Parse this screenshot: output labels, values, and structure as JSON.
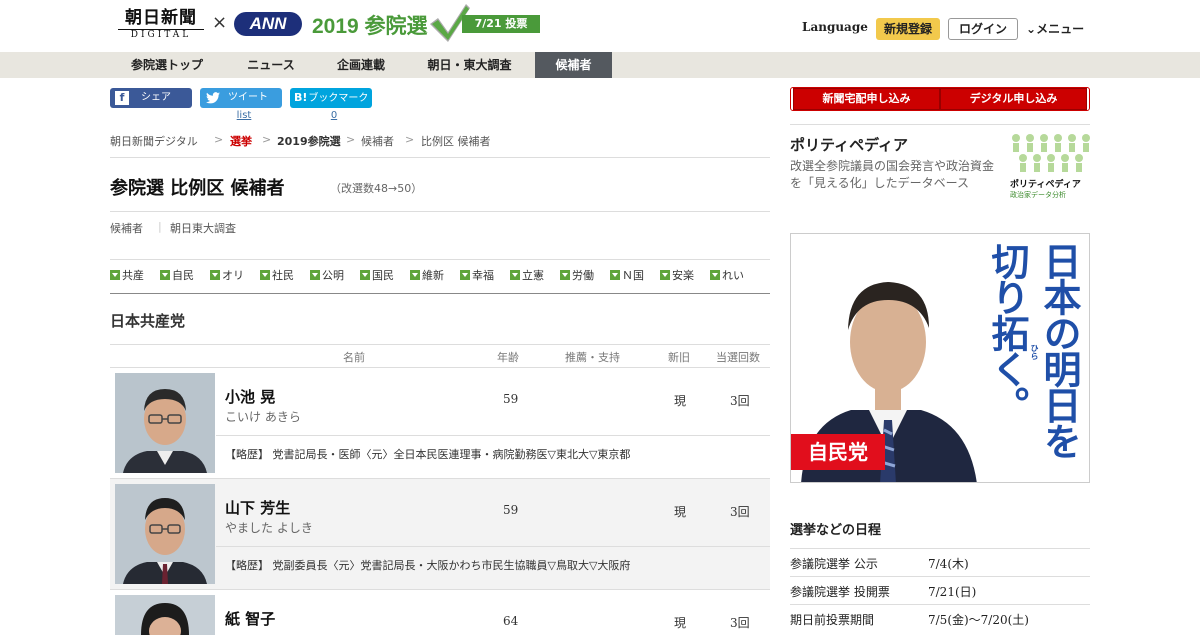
{
  "header": {
    "logo_asahi": "朝日新聞",
    "logo_digital": "DIGITAL",
    "logo_x": "×",
    "logo_ann": "ANN",
    "logo_election": "2019 参院選",
    "logo_vote": "7/21 投票",
    "language": "Language",
    "register": "新規登録",
    "login": "ログイン",
    "menu": "メニュー"
  },
  "nav": {
    "items": [
      "参院選トップ",
      "ニュース",
      "企画連載",
      "朝日・東大調査",
      "候補者"
    ],
    "active_index": 4
  },
  "share": {
    "facebook": "シェア",
    "twitter": "ツイート",
    "hatena": "ブックマーク",
    "twitter_count": "list",
    "hatena_count": "0"
  },
  "breadcrumb": [
    "朝日新聞デジタル",
    "選挙",
    "2019参院選",
    "候補者",
    "比例区 候補者"
  ],
  "page": {
    "title": "参院選 比例区 候補者",
    "subtitle": "（改選数48→50）",
    "subtabs": [
      "候補者",
      "朝日東大調査"
    ]
  },
  "parties": [
    "共産",
    "自民",
    "オリ",
    "社民",
    "公明",
    "国民",
    "維新",
    "幸福",
    "立憲",
    "労働",
    "Ｎ国",
    "安楽",
    "れい"
  ],
  "section": {
    "party_name": "日本共産党"
  },
  "table": {
    "headers": [
      "名前",
      "年齢",
      "推薦・支持",
      "新旧",
      "当選回数"
    ],
    "rows": [
      {
        "name": "小池 晃",
        "kana": "こいけ あきら",
        "age": "59",
        "status": "現",
        "times": "3回",
        "bio": "【略歴】 党書記局長・医師〈元〉全日本民医連理事・病院勤務医▽東北大▽東京都"
      },
      {
        "name": "山下 芳生",
        "kana": "やました よしき",
        "age": "59",
        "status": "現",
        "times": "3回",
        "bio": "【略歴】 党副委員長〈元〉党書記局長・大阪かわち市民生協職員▽鳥取大▽大阪府"
      },
      {
        "name": "紙 智子",
        "kana": "",
        "age": "64",
        "status": "現",
        "times": "3回",
        "bio": ""
      }
    ]
  },
  "sidebar": {
    "subscribe_paper": "新聞宅配申し込み",
    "subscribe_digital": "デジタル申し込み",
    "polity_title": "ポリティペディア",
    "polity_desc": "改選全参院議員の国会発言や政治資金を「見える化」したデータベース",
    "polity_logo": "ポリティペディア",
    "polity_logo_sub": "政治家データ分析",
    "ad_slogan_1": "日本の明日を",
    "ad_slogan_2": "切り拓く。",
    "ad_ruby": "ひら",
    "ad_party": "自民党",
    "schedule_title": "選挙などの日程",
    "schedule": [
      {
        "label": "参議院選挙 公示",
        "date": "7/4(木)"
      },
      {
        "label": "参議院選挙 投開票",
        "date": "7/21(日)"
      },
      {
        "label": "期日前投票期間",
        "date": "7/5(金)～7/20(土)"
      }
    ]
  },
  "colors": {
    "accent_red": "#c00000",
    "nav_bg": "#e8e6df",
    "nav_active": "#54595f",
    "register": "#f2c94c",
    "party_tab_green": "#5fa43a",
    "election_green": "#4a9a3a",
    "ann_blue": "#1d2f7a"
  }
}
